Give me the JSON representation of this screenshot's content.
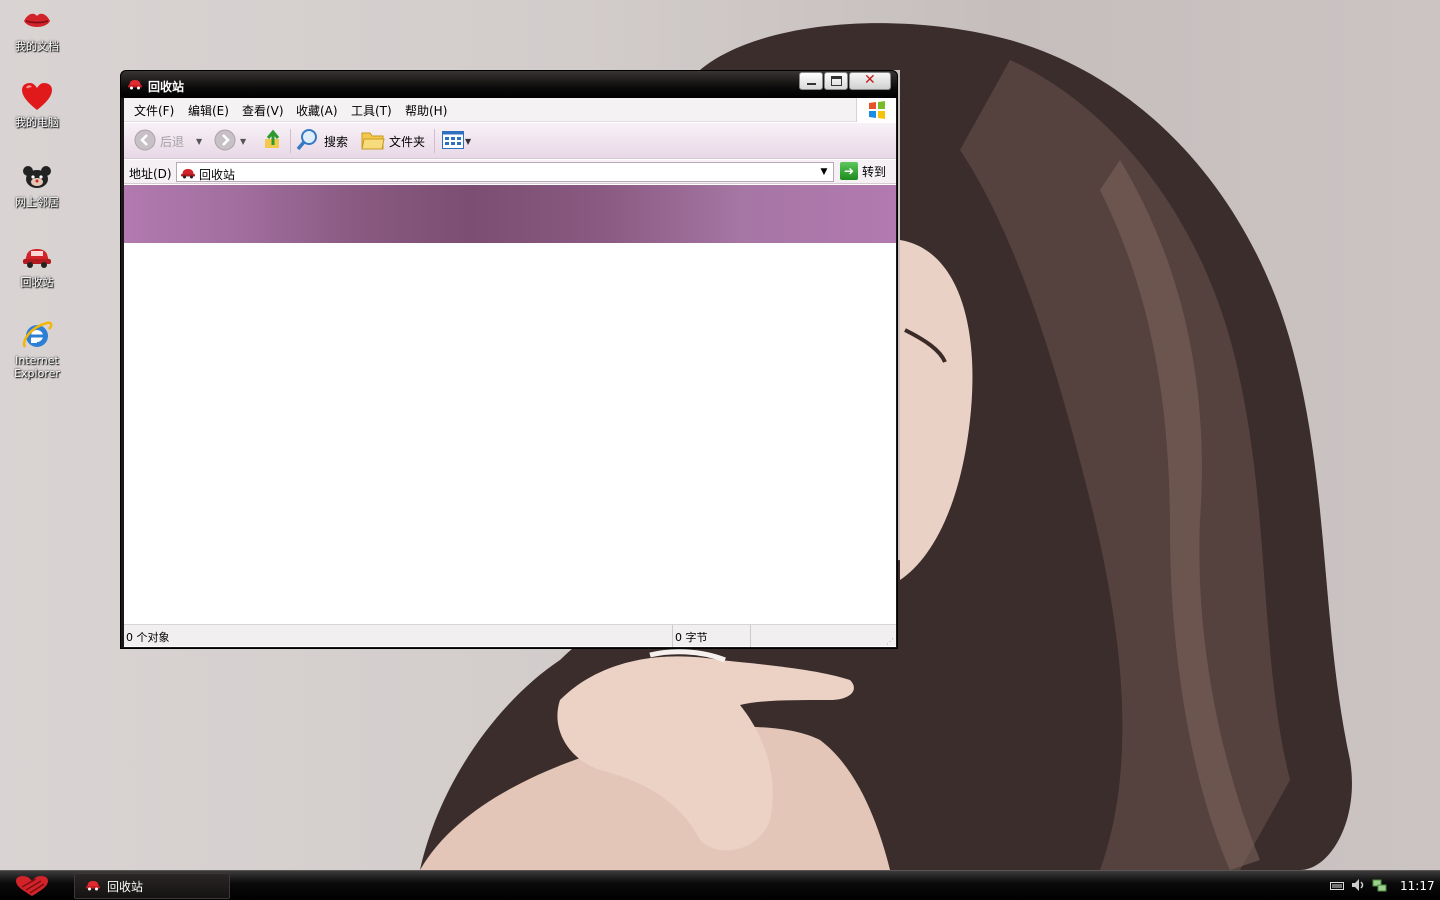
{
  "desktop": {
    "icons": [
      {
        "label": "我的文档",
        "icon": "lips-icon"
      },
      {
        "label": "我的电脑",
        "icon": "heart-icon"
      },
      {
        "label": "网上邻居",
        "icon": "mouse-icon"
      },
      {
        "label": "回收站",
        "icon": "car-icon"
      },
      {
        "label": "Internet Explorer",
        "icon": "internet-explorer-icon"
      }
    ]
  },
  "window": {
    "title": "回收站",
    "menu": {
      "file": "文件(F)",
      "edit": "编辑(E)",
      "view": "查看(V)",
      "favorites": "收藏(A)",
      "tools": "工具(T)",
      "help": "帮助(H)"
    },
    "toolbar": {
      "back": "后退",
      "search": "搜索",
      "folders": "文件夹"
    },
    "address": {
      "label": "地址(D)",
      "value": "回收站",
      "go": "转到"
    },
    "status": {
      "objects": "0 个对象",
      "size": "0 字节"
    }
  },
  "taskbar": {
    "task_label": "回收站",
    "clock": "11:17"
  },
  "colors": {
    "banner_dark": "#7c4e73",
    "banner_light": "#b27ab0",
    "titlebar": "#0d0b0b",
    "taskbar": "#000000"
  }
}
